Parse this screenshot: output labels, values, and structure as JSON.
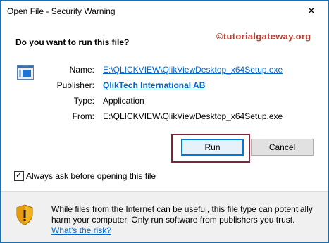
{
  "window": {
    "title": "Open File - Security Warning",
    "close_glyph": "✕"
  },
  "dialog": {
    "question": "Do you want to run this file?",
    "watermark": "©tutorialgateway.org"
  },
  "file_info": {
    "name_label": "Name:",
    "name_value": "E:\\QLICKVIEW\\QlikViewDesktop_x64Setup.exe",
    "publisher_label": "Publisher:",
    "publisher_value": "QlikTech International AB",
    "type_label": "Type:",
    "type_value": "Application",
    "from_label": "From:",
    "from_value": "E:\\QLICKVIEW\\QlikViewDesktop_x64Setup.exe"
  },
  "buttons": {
    "run": "Run",
    "cancel": "Cancel"
  },
  "checkbox": {
    "label": "Always ask before opening this file",
    "checked_glyph": "✓"
  },
  "footer": {
    "warning": "While files from the Internet can be useful, this file type can potentially harm your computer. Only run software from publishers you trust.",
    "risk_link": "What's the risk?"
  },
  "colors": {
    "accent": "#0078d7",
    "link": "#0066cc",
    "highlight_frame": "#7a2638",
    "watermark": "#c0392b"
  },
  "icons": {
    "app": "application-window-icon",
    "shield": "warning-shield-icon",
    "close": "close-icon"
  }
}
